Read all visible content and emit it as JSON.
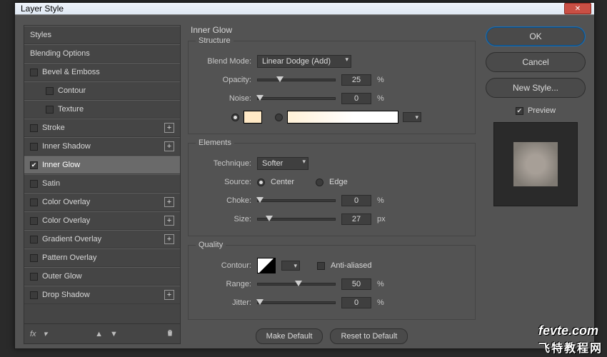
{
  "title": "Layer Style",
  "left": {
    "styles": "Styles",
    "blending": "Blending Options",
    "items": [
      {
        "label": "Bevel & Emboss",
        "plus": false,
        "checked": false,
        "indent": 0
      },
      {
        "label": "Contour",
        "plus": false,
        "checked": false,
        "indent": 1
      },
      {
        "label": "Texture",
        "plus": false,
        "checked": false,
        "indent": 1
      },
      {
        "label": "Stroke",
        "plus": true,
        "checked": false,
        "indent": 0
      },
      {
        "label": "Inner Shadow",
        "plus": true,
        "checked": false,
        "indent": 0
      },
      {
        "label": "Inner Glow",
        "plus": false,
        "checked": true,
        "indent": 0,
        "selected": true
      },
      {
        "label": "Satin",
        "plus": false,
        "checked": false,
        "indent": 0
      },
      {
        "label": "Color Overlay",
        "plus": true,
        "checked": false,
        "indent": 0
      },
      {
        "label": "Color Overlay",
        "plus": true,
        "checked": false,
        "indent": 0
      },
      {
        "label": "Gradient Overlay",
        "plus": true,
        "checked": false,
        "indent": 0
      },
      {
        "label": "Pattern Overlay",
        "plus": false,
        "checked": false,
        "indent": 0
      },
      {
        "label": "Outer Glow",
        "plus": false,
        "checked": false,
        "indent": 0
      },
      {
        "label": "Drop Shadow",
        "plus": true,
        "checked": false,
        "indent": 0
      }
    ],
    "fx": "fx"
  },
  "panel": {
    "title": "Inner Glow",
    "structure": {
      "legend": "Structure",
      "blendmode_label": "Blend Mode:",
      "blendmode_value": "Linear Dodge (Add)",
      "opacity_label": "Opacity:",
      "opacity_value": "25",
      "noise_label": "Noise:",
      "noise_value": "0",
      "pct": "%",
      "color": "#ffe9c6"
    },
    "elements": {
      "legend": "Elements",
      "technique_label": "Technique:",
      "technique_value": "Softer",
      "source_label": "Source:",
      "source_center": "Center",
      "source_edge": "Edge",
      "choke_label": "Choke:",
      "choke_value": "0",
      "size_label": "Size:",
      "size_value": "27",
      "px": "px",
      "pct": "%"
    },
    "quality": {
      "legend": "Quality",
      "contour_label": "Contour:",
      "aa_label": "Anti-aliased",
      "range_label": "Range:",
      "range_value": "50",
      "jitter_label": "Jitter:",
      "jitter_value": "0",
      "pct": "%"
    },
    "make_default": "Make Default",
    "reset_default": "Reset to Default"
  },
  "right": {
    "ok": "OK",
    "cancel": "Cancel",
    "newstyle": "New Style...",
    "preview": "Preview"
  },
  "watermark": {
    "en": "fevte.com",
    "cn": "飞特教程网"
  }
}
